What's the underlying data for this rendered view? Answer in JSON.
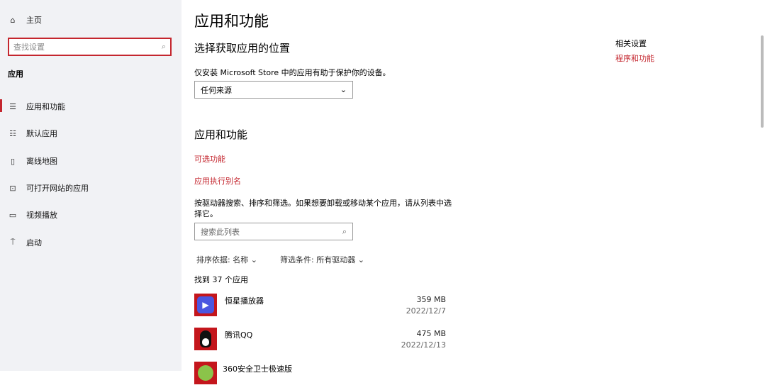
{
  "sidebar": {
    "home": "主页",
    "search_placeholder": "查找设置",
    "section": "应用",
    "items": [
      {
        "label": "应用和功能",
        "icon": "list-icon"
      },
      {
        "label": "默认应用",
        "icon": "default-apps-icon"
      },
      {
        "label": "离线地图",
        "icon": "map-icon"
      },
      {
        "label": "可打开网站的应用",
        "icon": "web-app-icon"
      },
      {
        "label": "视频播放",
        "icon": "video-icon"
      },
      {
        "label": "启动",
        "icon": "startup-icon"
      }
    ]
  },
  "main": {
    "title": "应用和功能",
    "location_heading": "选择获取应用的位置",
    "location_desc": "仅安装 Microsoft Store 中的应用有助于保护你的设备。",
    "source_value": "任何来源",
    "apps_heading": "应用和功能",
    "optional_features": "可选功能",
    "alias": "应用执行别名",
    "search_desc": "按驱动器搜索、排序和筛选。如果想要卸载或移动某个应用，请从列表中选择它。",
    "search_placeholder": "搜索此列表",
    "sort_label": "排序依据: 名称",
    "filter_label": "筛选条件: 所有驱动器",
    "count": "找到 37 个应用",
    "apps": [
      {
        "name": "恒星播放器",
        "size": "359 MB",
        "date": "2022/12/7"
      },
      {
        "name": "腾讯QQ",
        "size": "475 MB",
        "date": "2022/12/13"
      },
      {
        "name": "360安全卫士极速版"
      }
    ]
  },
  "related": {
    "heading": "相关设置",
    "link": "程序和功能"
  },
  "colors": {
    "accent": "#c4262e",
    "sidebar_bg": "#f1f2f5"
  }
}
